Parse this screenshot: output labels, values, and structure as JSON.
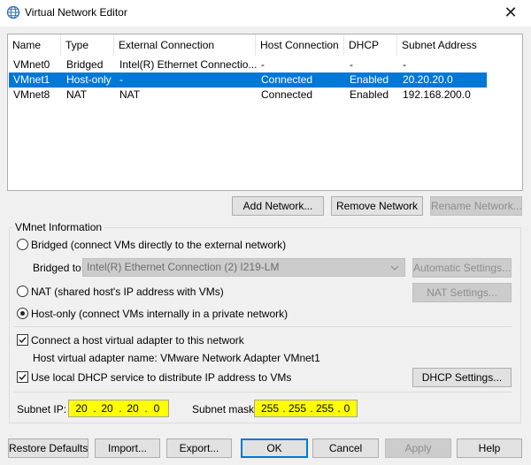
{
  "window": {
    "title": "Virtual Network Editor",
    "close_glyph": "✕",
    "icon": "globe-icon"
  },
  "list": {
    "columns": [
      "Name",
      "Type",
      "External Connection",
      "Host Connection",
      "DHCP",
      "Subnet Address"
    ],
    "rows": [
      [
        "VMnet0",
        "Bridged",
        "Intel(R) Ethernet Connectio...",
        "-",
        "-",
        "-"
      ],
      [
        "VMnet1",
        "Host-only",
        "-",
        "Connected",
        "Enabled",
        "20.20.20.0"
      ],
      [
        "VMnet8",
        "NAT",
        "NAT",
        "Connected",
        "Enabled",
        "192.168.200.0"
      ]
    ],
    "selected_row": 1,
    "selection_color": "#0078d7"
  },
  "network_buttons": {
    "add": "Add Network...",
    "remove": "Remove Network",
    "rename": "Rename Network..."
  },
  "vmnet_info": {
    "legend": "VMnet Information",
    "bridged_label": "Bridged (connect VMs directly to the external network)",
    "bridged_to_label": "Bridged to:",
    "bridged_to_value": "Intel(R) Ethernet Connection (2) I219-LM",
    "automatic_settings": "Automatic Settings...",
    "nat_label": "NAT (shared host's IP address with VMs)",
    "nat_settings": "NAT Settings...",
    "hostonly_label": "Host-only (connect VMs internally in a private network)",
    "selected_mode": "host-only",
    "connect_adapter_label": "Connect a host virtual adapter to this network",
    "connect_adapter_checked": true,
    "adapter_name_label": "Host virtual adapter name: VMware Network Adapter VMnet1",
    "dhcp_label": "Use local DHCP service to distribute IP address to VMs",
    "dhcp_checked": true,
    "dhcp_settings": "DHCP Settings...",
    "subnet_ip_label": "Subnet IP:",
    "subnet_ip": [
      "20",
      "20",
      "20",
      "0"
    ],
    "subnet_mask_label": "Subnet mask:",
    "subnet_mask": [
      "255",
      "255",
      "255",
      "0"
    ],
    "highlight_color": "#ffff00"
  },
  "footer": {
    "restore": "Restore Defaults",
    "import": "Import...",
    "export": "Export...",
    "ok": "OK",
    "cancel": "Cancel",
    "apply": "Apply",
    "help": "Help"
  }
}
